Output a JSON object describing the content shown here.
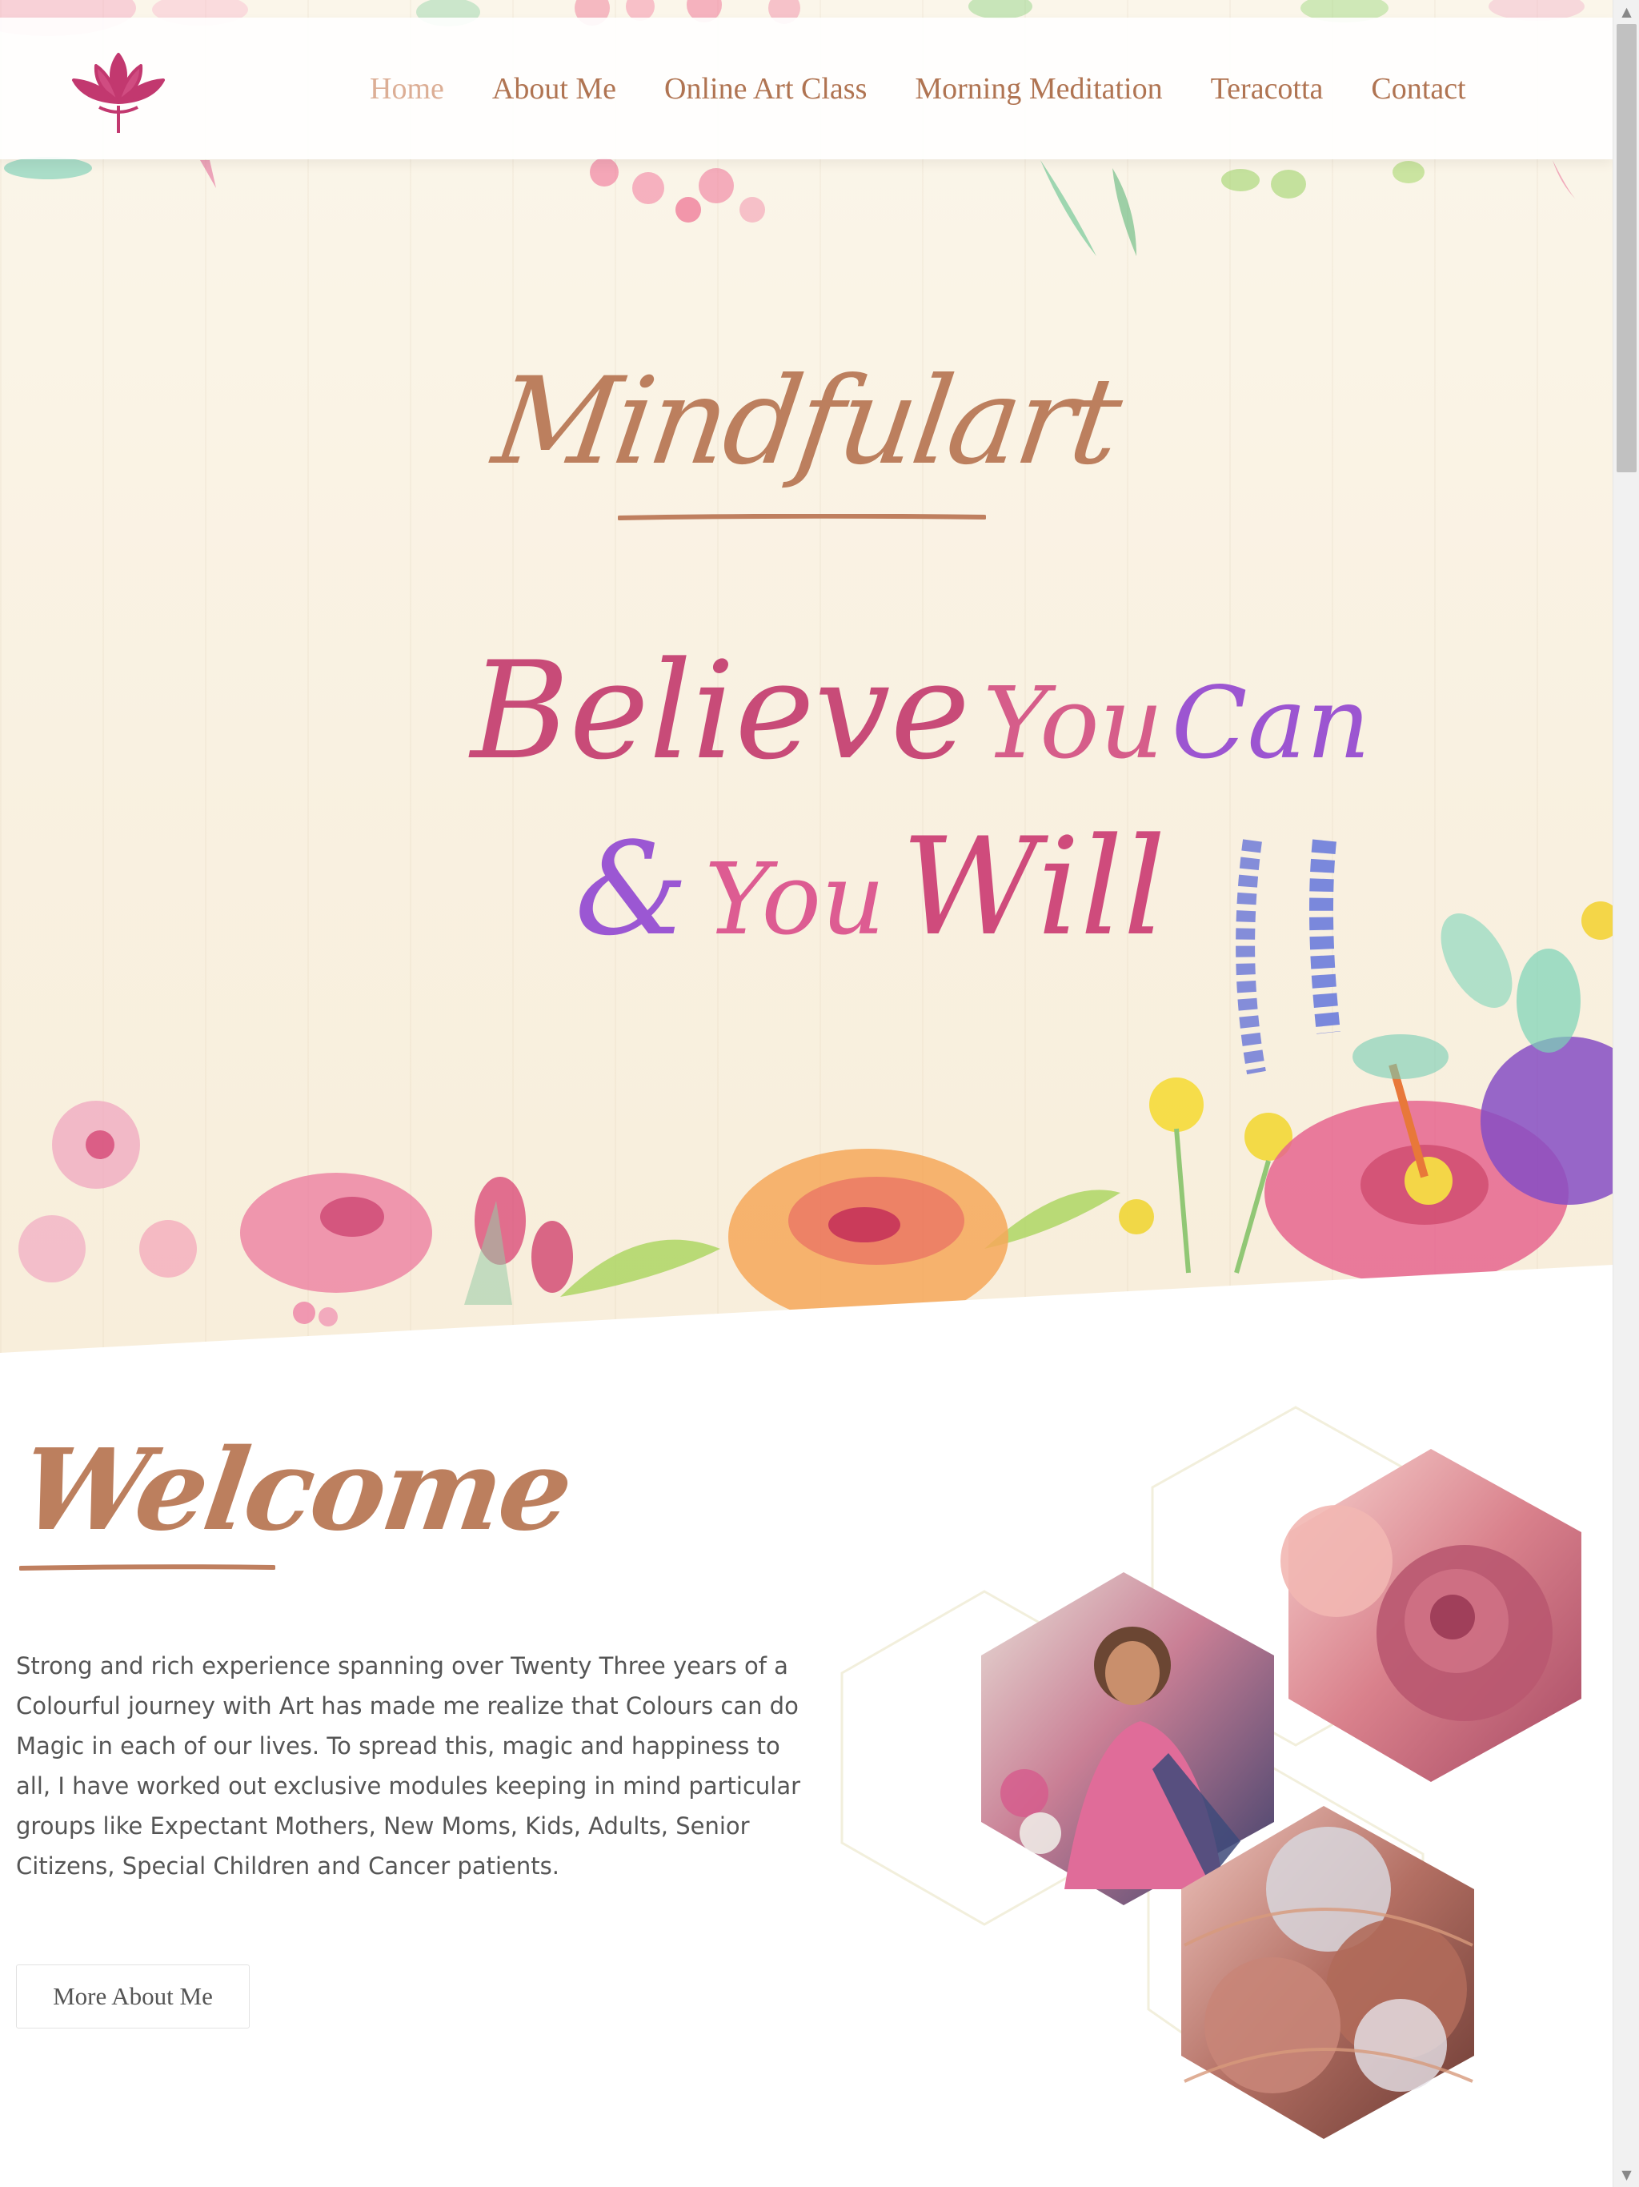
{
  "nav": {
    "logo_icon": "lotus-icon",
    "items": [
      {
        "label": "Home",
        "active": true
      },
      {
        "label": "About Me",
        "active": false
      },
      {
        "label": "Online Art Class",
        "active": false
      },
      {
        "label": "Morning Meditation",
        "active": false
      },
      {
        "label": "Teracotta",
        "active": false
      },
      {
        "label": "Contact",
        "active": false
      }
    ]
  },
  "hero": {
    "brand": "Mindfulart",
    "quote": {
      "believe": "Believe",
      "you": "You",
      "can": "Can",
      "amp": "&",
      "you2": "You",
      "will": "Will"
    }
  },
  "welcome": {
    "title": "Welcome",
    "text": "Strong and rich experience spanning over Twenty Three years of a Colourful journey with Art has made me realize that Colours can do Magic in each of our lives. To spread this, magic and happiness to all, I have worked out exclusive modules keeping in mind particular groups like Expectant Mothers, New Moms, Kids, Adults, Senior Citizens, Special Children and Cancer patients.",
    "button_label": "More About Me"
  },
  "colors": {
    "accent": "#bc7f5e",
    "nav_text": "#b07452",
    "nav_active": "#dcae95",
    "logo": "#c2386f",
    "quote_pink": "#c84b78",
    "quote_purple": "#9c55d1",
    "body_text": "#555555"
  },
  "scrollbar": {
    "up_icon": "scroll-up-arrow-icon",
    "down_icon": "scroll-down-arrow-icon",
    "position": 0
  }
}
